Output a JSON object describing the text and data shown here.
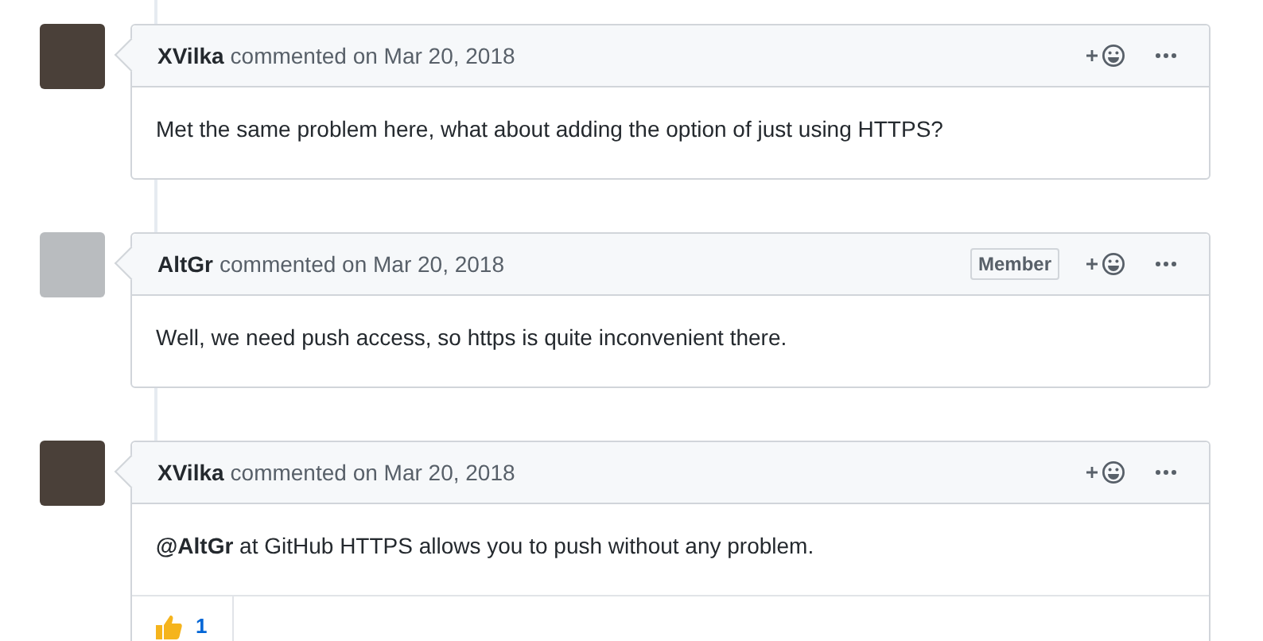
{
  "comments": [
    {
      "author": "XVilka",
      "action": "commented on Mar 20, 2018",
      "body": "Met the same problem here, what about adding the option of just using HTTPS?"
    },
    {
      "author": "AltGr",
      "action": "commented on Mar 20, 2018",
      "badge": "Member",
      "body": "Well, we need push access, so https is quite inconvenient there."
    },
    {
      "author": "XVilka",
      "action": "commented on Mar 20, 2018",
      "mention": "@AltGr",
      "body": "at GitHub HTTPS allows you to push without any problem.",
      "reactions": [
        {
          "count": "1"
        }
      ]
    }
  ]
}
